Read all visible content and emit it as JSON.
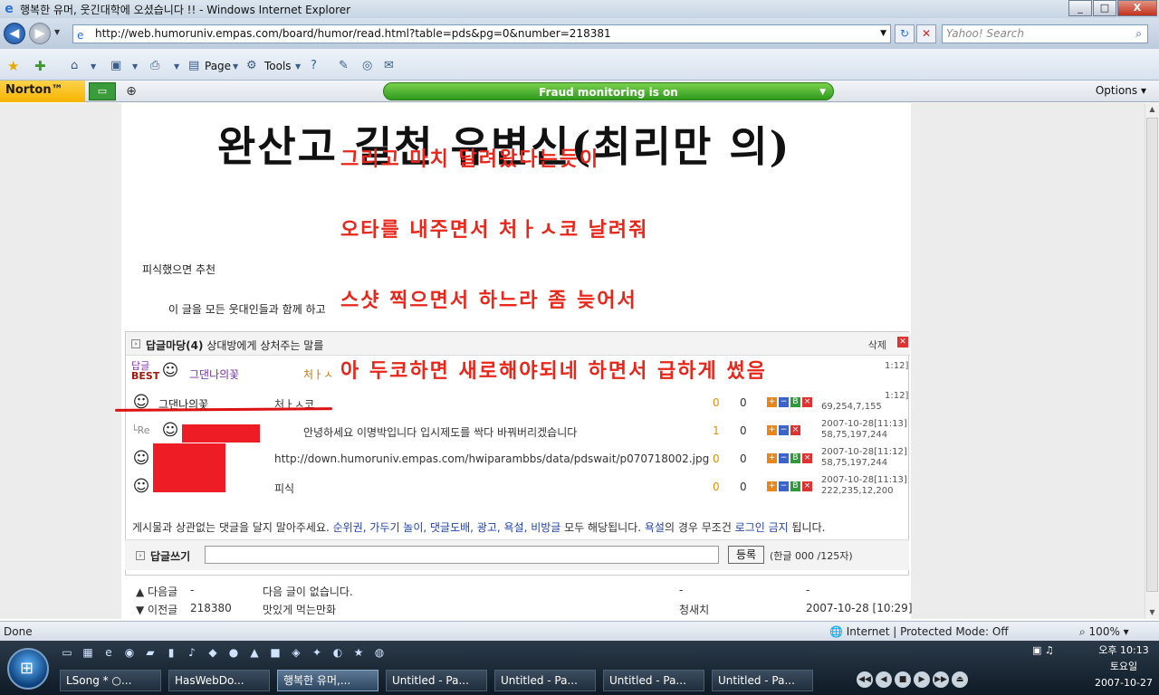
{
  "window": {
    "title": "행복한 유머, 웃긴대학에 오셨습니다 !! - Windows Internet Explorer",
    "controls": {
      "minimize": "_",
      "maximize": "□",
      "close": "X"
    }
  },
  "addressbar": {
    "url": "http://web.humoruniv.empas.com/board/humor/read.html?table=pds&pg=0&number=218381",
    "search_placeholder": "Yahoo! Search"
  },
  "commandbar": {
    "page_label": "Page",
    "tools_label": "Tools"
  },
  "norton": {
    "logo": "Norton™",
    "fraud_status": "Fraud monitoring is on",
    "options_label": "Options"
  },
  "post": {
    "big_title": "완산고 길천 유변신(최리만 의)",
    "text_line": "피식했으면 추천",
    "share_line": "이 글을 모든 웃대인들과 함께 하고"
  },
  "overlay_notes": [
    "그리고 마치 달려왔다는듯이",
    "오타를 내주면서 처ㅏㅅ코 날려줘",
    "스샷 찍으면서 하느라 좀 늦어서",
    "아 두코하면 새로해야되네 하면서 급하게 썼음"
  ],
  "comments": {
    "header_title": "답글마당(4)",
    "header_sub": "상대방에게 상처주는 말를",
    "delete_label": "삭제",
    "best_label_top": "답글",
    "best_label_bottom": "BEST",
    "best_name": "그댄나의꽃",
    "best_msg": "처ㅏㅅ",
    "best_time_partial": "1:12]",
    "rows": [
      {
        "name": "그댄나의꽃",
        "msg": "처ㅏㅅ코",
        "up": "0",
        "down": "0",
        "date": "1:12]",
        "ip": "69,254,7,155"
      },
      {
        "prefix": "└Re",
        "msg": "안녕하세요 이명박입니다 입시제도를 싹다 바꿔버리겠습니다",
        "up": "1",
        "down": "0",
        "date": "2007-10-28[11:13]",
        "ip": "58,75,197,244"
      },
      {
        "msg": "http://down.humoruniv.empas.com/hwiparambbs/data/pdswait/p070718002.jpg",
        "up": "0",
        "down": "0",
        "date": "2007-10-28[11:12]",
        "ip": "58,75,197,244"
      },
      {
        "msg": "피식",
        "up": "0",
        "down": "0",
        "date": "2007-10-28[11:13]",
        "ip": "222,235,12,200"
      }
    ],
    "notice_prefix": "게시물과 상관없는 댓글을 달지 말아주세요. ",
    "notice_blue1": "순위권, 가두기 놀이, 댓글도배, 광고, 욕설, 비방글",
    "notice_mid1": " 모두 해당됩니다. ",
    "notice_blue2": "욕설",
    "notice_mid2": "의 경우 무조건 ",
    "notice_blue3": "로그인 금지",
    "notice_suffix": " 됩니다.",
    "reply_label": "답글쓰기",
    "submit_label": "등록",
    "char_count": "(한글 000 /125자)"
  },
  "navigation": [
    {
      "dir": "▲ 다음글",
      "num": "-",
      "title": "다음 글이 없습니다.",
      "author": "-",
      "date": "-"
    },
    {
      "dir": "▼ 이전글",
      "num": "218380",
      "title": "맛있게 먹는만화",
      "author": "청새치",
      "date": "2007-10-28 [10:29]"
    }
  ],
  "statusbar": {
    "done": "Done",
    "zone": "Internet | Protected Mode: Off",
    "zoom": "100%"
  },
  "taskbar": {
    "tasks": [
      {
        "label": "LSong * ○..."
      },
      {
        "label": "HasWebDo..."
      },
      {
        "label": "행복한 유머,..."
      },
      {
        "label": "Untitled - Pa..."
      },
      {
        "label": "Untitled - Pa..."
      },
      {
        "label": "Untitled - Pa..."
      },
      {
        "label": "Untitled - Pa..."
      }
    ],
    "clock_time": "오후 10:13",
    "clock_day": "토요일",
    "clock_date": "2007-10-27"
  }
}
